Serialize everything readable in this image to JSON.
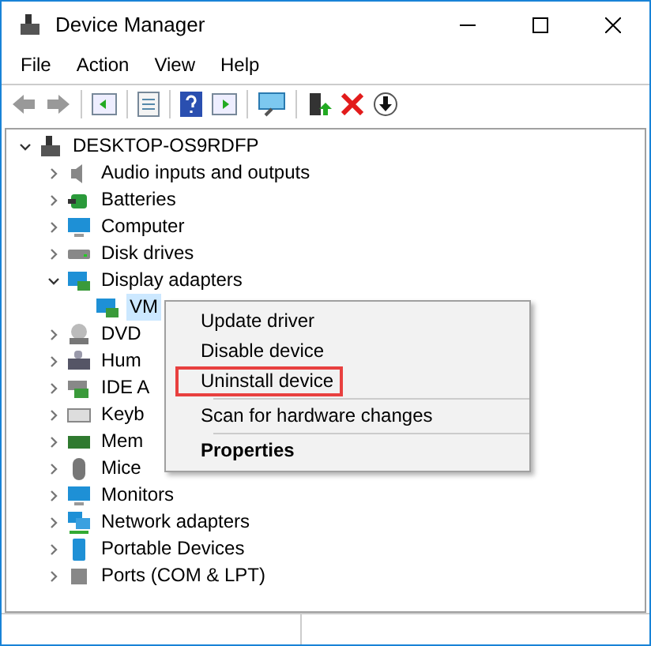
{
  "window": {
    "title": "Device Manager"
  },
  "menu_bar": [
    "File",
    "Action",
    "View",
    "Help"
  ],
  "tree": [
    {
      "label": "DESKTOP-OS9RDFP",
      "expanded": true,
      "selected": false,
      "children": [
        {
          "label": "Audio inputs and outputs",
          "expanded": false,
          "selected": false
        },
        {
          "label": "Batteries",
          "expanded": false,
          "selected": false
        },
        {
          "label": "Computer",
          "expanded": false,
          "selected": false
        },
        {
          "label": "Disk drives",
          "expanded": false,
          "selected": false
        },
        {
          "label": "Display adapters",
          "expanded": true,
          "selected": false,
          "children": [
            {
              "label": "VM",
              "selected": true
            }
          ]
        },
        {
          "label": "DVD",
          "expanded": false,
          "selected": false
        },
        {
          "label": "Hum",
          "expanded": false,
          "selected": false
        },
        {
          "label": "IDE A",
          "expanded": false,
          "selected": false
        },
        {
          "label": "Keyb",
          "expanded": false,
          "selected": false
        },
        {
          "label": "Mem",
          "expanded": false,
          "selected": false
        },
        {
          "label": "Mice",
          "expanded": false,
          "selected": false
        },
        {
          "label": "Monitors",
          "expanded": false,
          "selected": false
        },
        {
          "label": "Network adapters",
          "expanded": false,
          "selected": false
        },
        {
          "label": "Portable Devices",
          "expanded": false,
          "selected": false
        },
        {
          "label": "Ports (COM & LPT)",
          "expanded": false,
          "selected": false
        }
      ]
    }
  ],
  "context_menu": [
    {
      "label": "Update driver",
      "kind": "item",
      "highlighted": false
    },
    {
      "label": "Disable device",
      "kind": "item",
      "highlighted": false
    },
    {
      "label": "Uninstall device",
      "kind": "item",
      "highlighted": true
    },
    {
      "kind": "separator"
    },
    {
      "label": "Scan for hardware changes",
      "kind": "item",
      "highlighted": false
    },
    {
      "kind": "separator"
    },
    {
      "label": "Properties",
      "kind": "default",
      "highlighted": false
    }
  ]
}
